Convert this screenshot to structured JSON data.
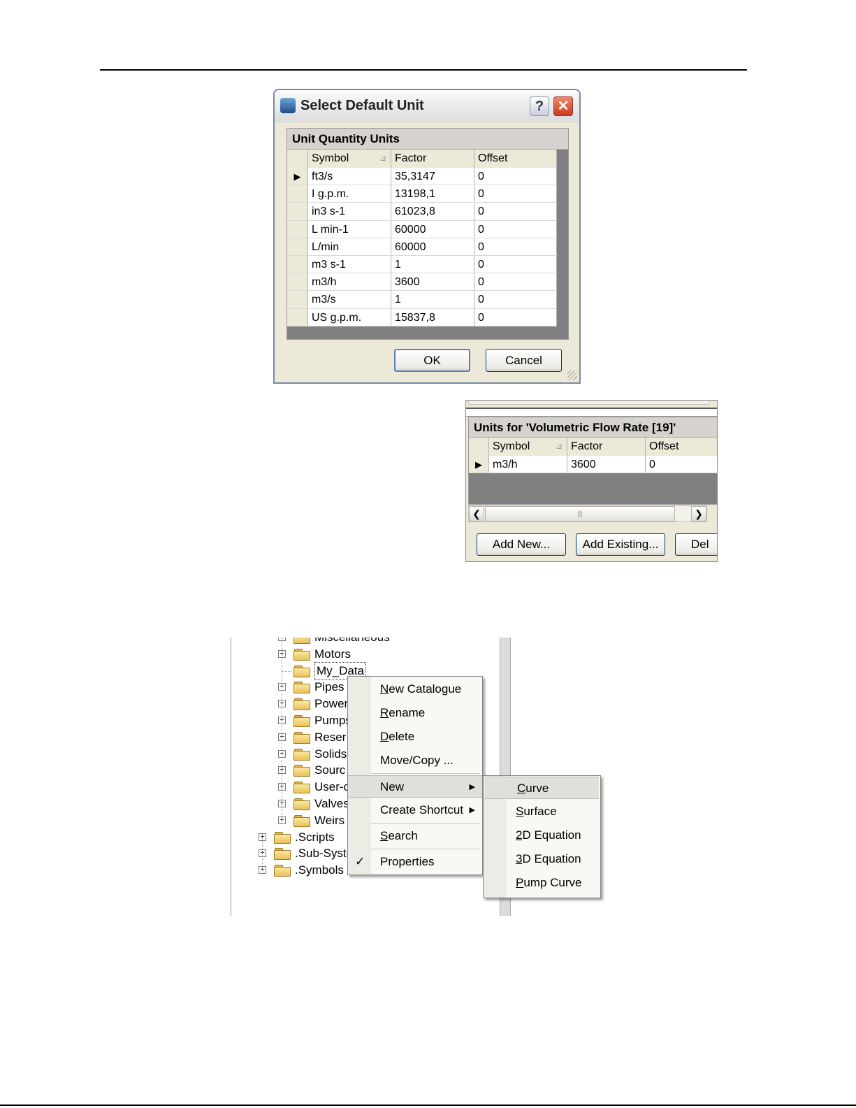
{
  "dialog": {
    "title": "Select Default Unit",
    "help_button": "?",
    "close_button": "✕",
    "grid_caption": "Unit Quantity Units",
    "columns": [
      "Symbol",
      "Factor",
      "Offset"
    ],
    "rows": [
      {
        "symbol": "ft3/s",
        "factor": "35,3147",
        "offset": "0",
        "current": true
      },
      {
        "symbol": "I g.p.m.",
        "factor": "13198,1",
        "offset": "0"
      },
      {
        "symbol": "in3 s-1",
        "factor": "61023,8",
        "offset": "0"
      },
      {
        "symbol": "L min-1",
        "factor": "60000",
        "offset": "0"
      },
      {
        "symbol": "L/min",
        "factor": "60000",
        "offset": "0"
      },
      {
        "symbol": "m3 s-1",
        "factor": "1",
        "offset": "0"
      },
      {
        "symbol": "m3/h",
        "factor": "3600",
        "offset": "0"
      },
      {
        "symbol": "m3/s",
        "factor": "1",
        "offset": "0"
      },
      {
        "symbol": "US g.p.m.",
        "factor": "15837,8",
        "offset": "0"
      }
    ],
    "ok_label": "OK",
    "cancel_label": "Cancel"
  },
  "units_panel": {
    "caption": "Units for 'Volumetric Flow Rate [19]'",
    "columns": [
      "Symbol",
      "Factor",
      "Offset"
    ],
    "rows": [
      {
        "symbol": "m3/h",
        "factor": "3600",
        "offset": "0",
        "current": true
      }
    ],
    "add_new_label": "Add New...",
    "add_existing_label": "Add Existing...",
    "delete_label": "Del"
  },
  "tree": {
    "nodes": [
      {
        "label": "Miscellaneous",
        "level": 2,
        "expandable": true
      },
      {
        "label": "Motors",
        "level": 2,
        "expandable": true
      },
      {
        "label": "My_Data",
        "level": 2,
        "expandable": false,
        "selected": true
      },
      {
        "label": "Pipes",
        "level": 2,
        "expandable": true
      },
      {
        "label": "Power",
        "level": 2,
        "expandable": true
      },
      {
        "label": "Pumps",
        "level": 2,
        "expandable": true
      },
      {
        "label": "Reser",
        "level": 2,
        "expandable": true
      },
      {
        "label": "Solids",
        "level": 2,
        "expandable": true
      },
      {
        "label": "Sourc",
        "level": 2,
        "expandable": true
      },
      {
        "label": "User-c",
        "level": 2,
        "expandable": true
      },
      {
        "label": "Valves",
        "level": 2,
        "expandable": true
      },
      {
        "label": "Weirs",
        "level": 2,
        "expandable": true
      },
      {
        "label": ".Scripts",
        "level": 1,
        "expandable": true
      },
      {
        "label": ".Sub-Syste",
        "level": 1,
        "expandable": true
      },
      {
        "label": ".Symbols",
        "level": 1,
        "expandable": true
      }
    ]
  },
  "context_menu": {
    "items": [
      {
        "label": "New Catalogue",
        "mnemonic": "N"
      },
      {
        "label": "Rename",
        "mnemonic": "R"
      },
      {
        "label": "Delete",
        "mnemonic": "D"
      },
      {
        "label": "Move/Copy ...",
        "mnemonic": ""
      },
      {
        "label": "New",
        "mnemonic": "",
        "submenu": true,
        "highlighted": true
      },
      {
        "label": "Create Shortcut",
        "mnemonic": "",
        "submenu": true
      },
      {
        "label": "Search",
        "mnemonic": "S"
      },
      {
        "label": "Properties",
        "mnemonic": "",
        "checked": true
      }
    ]
  },
  "submenu": {
    "items": [
      {
        "label": "Curve",
        "mnemonic": "C",
        "highlighted": true
      },
      {
        "label": "Surface",
        "mnemonic": "S"
      },
      {
        "label": "2D Equation",
        "mnemonic": "2"
      },
      {
        "label": "3D Equation",
        "mnemonic": "3"
      },
      {
        "label": "Pump Curve",
        "mnemonic": "P"
      }
    ]
  }
}
